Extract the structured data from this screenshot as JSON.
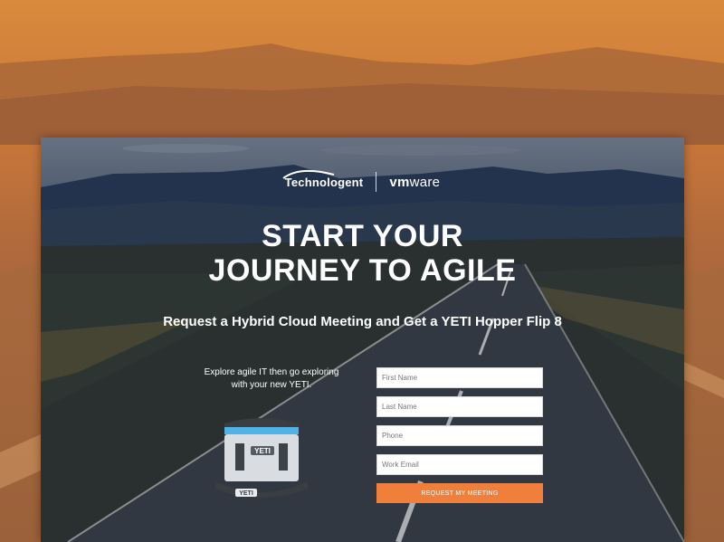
{
  "brand": {
    "partner_logo": "Technologent",
    "vendor_logo_prefix": "vm",
    "vendor_logo_suffix": "ware"
  },
  "hero": {
    "headline_line1": "START YOUR",
    "headline_line2": "JOURNEY TO AGILE",
    "subheadline": "Request a Hybrid Cloud Meeting and Get a YETI Hopper Flip 8"
  },
  "promo": {
    "text_line1": "Explore agile IT then go exploring",
    "text_line2": "with your new YETI.",
    "product_brand": "YETI"
  },
  "form": {
    "first_name_placeholder": "First Name",
    "last_name_placeholder": "Last Name",
    "phone_placeholder": "Phone",
    "email_placeholder": "Work Email",
    "submit_label": "REQUEST MY MEETING"
  },
  "colors": {
    "accent": "#ef7f3a",
    "background": "#c9773a"
  },
  "icons": [
    "technologent-logo-icon",
    "yeti-cooler-icon"
  ]
}
